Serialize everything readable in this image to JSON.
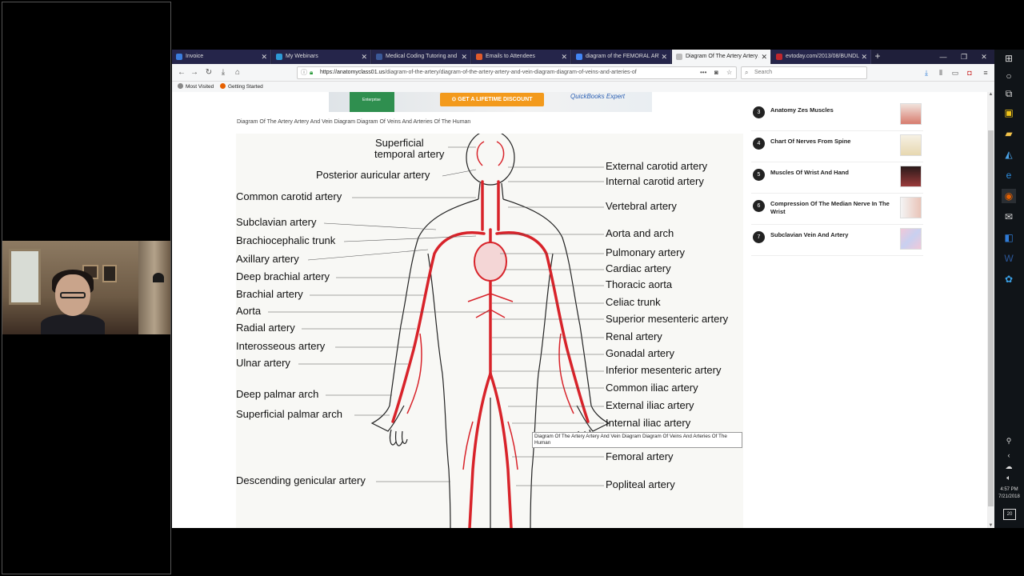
{
  "browser": {
    "tabs": [
      {
        "label": "Invoice",
        "color": "#3b7ddd"
      },
      {
        "label": "My Webinars",
        "color": "#2d9ad6"
      },
      {
        "label": "Medical Coding Tutoring and",
        "color": "#3b5998"
      },
      {
        "label": "Emails to Attendees",
        "color": "#e05a2b"
      },
      {
        "label": "diagram of the FEMORAL ARTE",
        "color": "#4285f4"
      },
      {
        "label": "Diagram Of The Artery Artery A",
        "color": "#999999",
        "active": true
      },
      {
        "label": "evtoday.com/2013/08/BUNDLI",
        "color": "#c0272d"
      }
    ],
    "url_host": "https://anatomyclass01.us",
    "url_path": "/diagram-of-the-artery/diagram-of-the-artery-artery-and-vein-diagram-diagram-of-veins-and-arteries-of",
    "search_placeholder": "Search",
    "bookmarks": [
      "Most Visited",
      "Getting Started"
    ]
  },
  "ad": {
    "cta": "⊙ GET A LIFETIME DISCOUNT",
    "brand": "QuickBooks Expert",
    "book_text": "Enterprise"
  },
  "page": {
    "image_title": "Diagram Of The Artery Artery And Vein Diagram Diagram Of Veins And Arteries Of The Human",
    "tooltip": "Diagram Of The Artery Artery And Vein Diagram Diagram Of Veins And Arteries Of The Human"
  },
  "diagram_labels": {
    "left": [
      "Superficial",
      "temporal artery",
      "Posterior auricular artery",
      "Common carotid artery",
      "Subclavian artery",
      "Brachiocephalic trunk",
      "Axillary artery",
      "Deep brachial artery",
      "Brachial artery",
      "Aorta",
      "Radial artery",
      "Interosseous artery",
      "Ulnar artery",
      "Deep palmar arch",
      "Superficial palmar arch",
      "Descending genicular artery"
    ],
    "right": [
      "External carotid artery",
      "Internal carotid artery",
      "Vertebral artery",
      "Aorta and arch",
      "Pulmonary artery",
      "Cardiac artery",
      "Thoracic aorta",
      "Celiac trunk",
      "Superior mesenteric artery",
      "Renal artery",
      "Gonadal artery",
      "Inferior mesenteric artery",
      "Common iliac artery",
      "External iliac artery",
      "Internal iliac artery",
      "Femoral artery",
      "Popliteal artery"
    ]
  },
  "sidebar": {
    "items": [
      {
        "num": "3",
        "title": "Anatomy Zes Muscles"
      },
      {
        "num": "4",
        "title": "Chart Of Nerves From Spine"
      },
      {
        "num": "5",
        "title": "Muscles Of Wrist And Hand"
      },
      {
        "num": "6",
        "title": "Compression Of The Median Nerve In The Wrist"
      },
      {
        "num": "7",
        "title": "Subclavian Vein And Artery"
      }
    ]
  },
  "taskbar": {
    "time": "4:57 PM",
    "date": "7/21/2018",
    "notifications": "20"
  },
  "colors": {
    "artery": "#d8232a",
    "accent": "#f39a1c"
  }
}
